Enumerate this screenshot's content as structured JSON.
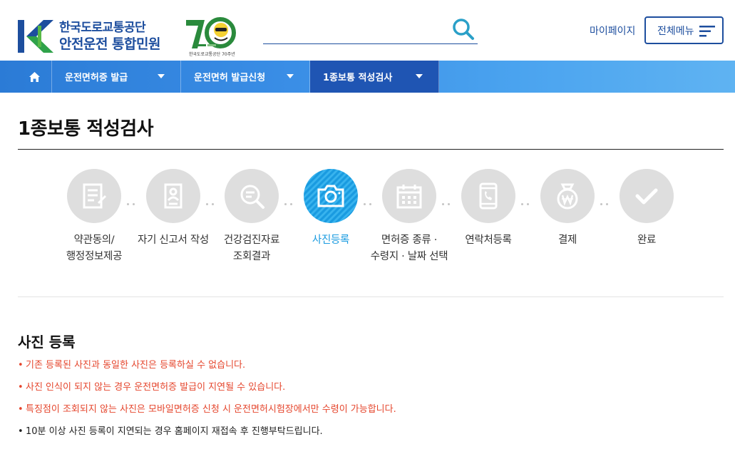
{
  "header": {
    "logo": {
      "org": "한국도로교통공단",
      "system": "안전운전 통합민원",
      "anniversary": "70",
      "anniversary_caption": "한국도로교통공단 70주년"
    },
    "search": {
      "placeholder": "",
      "value": ""
    },
    "mypage_label": "마이페이지",
    "allmenu_label": "전체메뉴"
  },
  "nav": {
    "items": [
      {
        "label": "운전면허증 발급"
      },
      {
        "label": "운전면허 발급신청"
      },
      {
        "label": "1종보통 적성검사",
        "active": true
      }
    ]
  },
  "page": {
    "title": "1종보통 적성검사"
  },
  "steps": [
    {
      "label_lines": [
        "약관동의/",
        "행정정보제공"
      ],
      "icon": "document-form-icon"
    },
    {
      "label_lines": [
        "자기 신고서 작성"
      ],
      "icon": "profile-document-icon"
    },
    {
      "label_lines": [
        "건강검진자료",
        "조회결과"
      ],
      "icon": "search-document-icon"
    },
    {
      "label_lines": [
        "사진등록"
      ],
      "icon": "camera-icon",
      "active": true
    },
    {
      "label_lines": [
        "면허증 종류 ·",
        "수령지 · 날짜 선택"
      ],
      "icon": "calendar-icon"
    },
    {
      "label_lines": [
        "연락처등록"
      ],
      "icon": "phone-icon"
    },
    {
      "label_lines": [
        "결제"
      ],
      "icon": "won-coin-icon"
    },
    {
      "label_lines": [
        "완료"
      ],
      "icon": "checkmark-icon"
    }
  ],
  "section": {
    "title": "사진 등록",
    "notes": [
      {
        "text": "기존 등록된 사진과 동일한 사진은 등록하실 수 없습니다.",
        "style": "warn"
      },
      {
        "text": "사진 인식이 되지 않는 경우 운전면허증 발급이 지연될 수 있습니다.",
        "style": "warn"
      },
      {
        "text": "특징점이 조회되지 않는 사진은 모바일면허증 신청 시 운전면허시험장에서만 수령이 가능합니다.",
        "style": "warn"
      },
      {
        "text": "10분 이상 사진 등록이 지연되는 경우 홈페이지 재접속 후 진행부탁드립니다.",
        "style": "plain"
      }
    ]
  },
  "colors": {
    "brand": "#1d4e9e",
    "nav_active": "#1f55b3",
    "step_active": "#1a9be0",
    "step_inactive": "#dedede",
    "warning": "#e5462d"
  }
}
